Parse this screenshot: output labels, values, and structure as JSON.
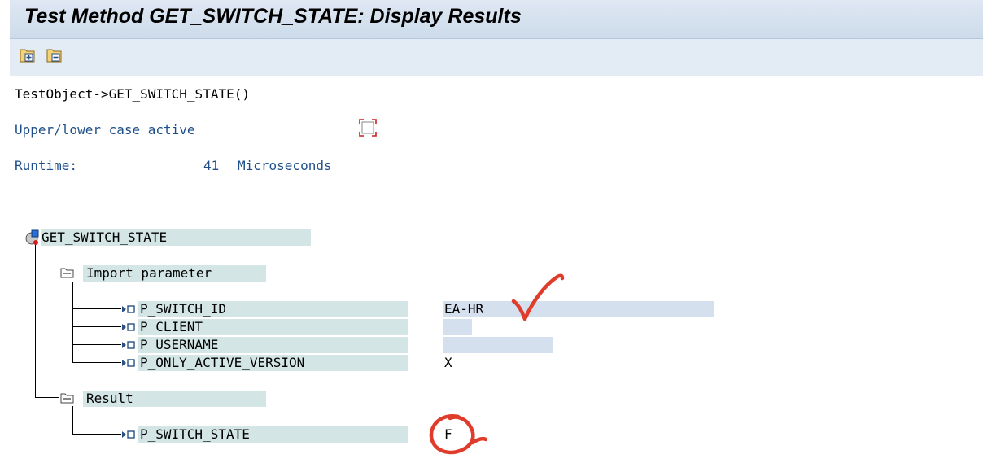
{
  "window": {
    "title": "Test Method GET_SWITCH_STATE: Display Results"
  },
  "toolbar": {
    "expand_icon": "expand-all-icon",
    "collapse_icon": "collapse-all-icon"
  },
  "header": {
    "call": "TestObject->GET_SWITCH_STATE()",
    "case_label": "Upper/lower case active",
    "case_checked": false,
    "runtime_label": "Runtime:",
    "runtime_value": "41",
    "runtime_unit": "Microseconds"
  },
  "tree": {
    "root": "GET_SWITCH_STATE",
    "import_folder": "Import parameter",
    "params": [
      {
        "name": "P_SWITCH_ID",
        "value": "EA-HR"
      },
      {
        "name": "P_CLIENT",
        "value": ""
      },
      {
        "name": "P_USERNAME",
        "value": ""
      },
      {
        "name": "P_ONLY_ACTIVE_VERSION",
        "value": "X"
      }
    ],
    "result_folder": "Result",
    "result": {
      "name": "P_SWITCH_STATE",
      "value": "F"
    }
  },
  "colors": {
    "annotation_red": "#e03c2c",
    "label_blue": "#1f4f8a",
    "node_bg": "#d3e5e5",
    "value_bg": "#d5e0ee"
  }
}
